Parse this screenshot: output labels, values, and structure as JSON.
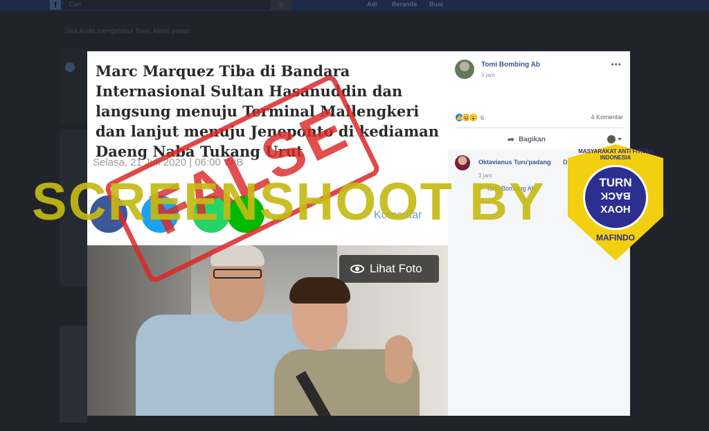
{
  "fb": {
    "logo": "f",
    "search_placeholder": "Cari",
    "search_icon": "search-icon",
    "nav_user": "Adi",
    "nav_home": "Beranda",
    "nav_create": "Buat",
    "notice": "Jika Anda mengetahui Tomi, kirimi pesan"
  },
  "article": {
    "title": "Marc Marquez Tiba di Bandara Internasional Sultan Hasanuddin dan langsung menuju Terminal Mallengkeri dan lanjut menuju Jeneponto di kediaman Daeng Naba Tukang Urut",
    "date": "Selasa, 21 Juli 2020 | 06:00 WIB",
    "comment_label": "Komentar",
    "share_icons": [
      "facebook-icon",
      "twitter-icon",
      "whatsapp-icon",
      "line-icon"
    ]
  },
  "photo": {
    "view_label": "Lihat Foto"
  },
  "post": {
    "poster_name": "Tomi Bombing Ab",
    "time": "3 jam",
    "reaction_count": "6",
    "comment_count": "4 Komentar",
    "share_label": "Bagikan"
  },
  "comment": {
    "name": "Oktavianus Turu'padang",
    "text": "Dukun b",
    "time": "3 jam",
    "reply_name": "Tomi Bombing Ab"
  },
  "overlay": {
    "watermark": "SCREENSHOOT BY",
    "stamp": "FALSE"
  },
  "badge": {
    "arc_text": "MASYARAKAT ANTI FITNAH INDONESIA",
    "line1": "TURN",
    "line2": "BACK",
    "line3": "HOAX",
    "bottom": "MAFINDO"
  },
  "colors": {
    "link_blue": "#365899",
    "stamp_red": "#da2828",
    "watermark_yellow": "#c4ba14",
    "badge_yellow": "#f2cf10",
    "badge_navy": "#2c2f8f"
  }
}
